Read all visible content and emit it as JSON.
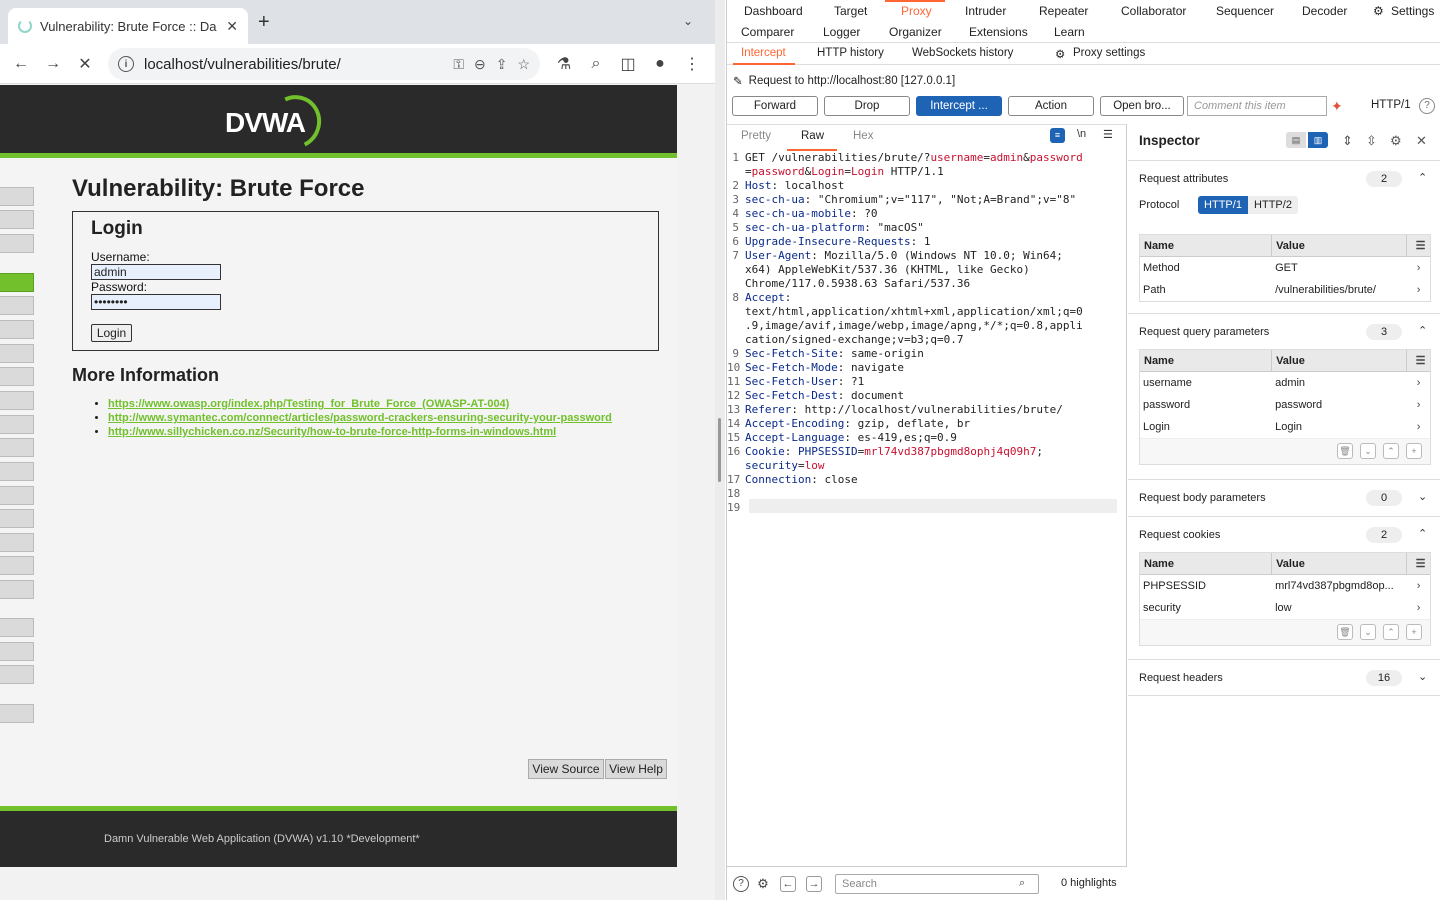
{
  "browser": {
    "tab_title": "Vulnerability: Brute Force :: Da",
    "url": "localhost/vulnerabilities/brute/"
  },
  "dvwa": {
    "logo": "DVWA",
    "page_title": "Vulnerability: Brute Force",
    "login_heading": "Login",
    "username_label": "Username:",
    "username_value": "admin",
    "password_label": "Password:",
    "password_value": "••••••••",
    "login_button": "Login",
    "more_info_heading": "More Information",
    "links": [
      "https://www.owasp.org/index.php/Testing_for_Brute_Force_(OWASP-AT-004)",
      "http://www.symantec.com/connect/articles/password-crackers-ensuring-security-your-password",
      "http://www.sillychicken.co.nz/Security/how-to-brute-force-http-forms-in-windows.html"
    ],
    "view_source": "View Source",
    "view_help": "View Help",
    "footer": "Damn Vulnerable Web Application (DVWA) v1.10 *Development*"
  },
  "burp": {
    "nav_row1": [
      "Dashboard",
      "Target",
      "Proxy",
      "Intruder",
      "Repeater",
      "Collaborator",
      "Sequencer",
      "Decoder",
      "Settings"
    ],
    "nav_row2": [
      "Comparer",
      "Logger",
      "Organizer",
      "Extensions",
      "Learn"
    ],
    "subnav": [
      "Intercept",
      "HTTP history",
      "WebSockets history",
      "Proxy settings"
    ],
    "request_to": "Request to http://localhost:80  [127.0.0.1]",
    "buttons": [
      "Forward",
      "Drop",
      "Intercept ...",
      "Action",
      "Open bro..."
    ],
    "comment_placeholder": "Comment this item",
    "http_version": "HTTP/1",
    "editor_tabs": [
      "Pretty",
      "Raw",
      "Hex"
    ],
    "newline_toggle": "\\n",
    "search_placeholder": "Search",
    "highlights": "0 highlights",
    "code_lines": [
      {
        "n": "1",
        "html": "GET /vulnerabilities/brute/?<span class='v'>username</span>=<span class='v'>admin</span>&amp;<span class='v'>password</span>"
      },
      {
        "n": "",
        "html": "=<span class='v'>password</span>&amp;<span class='v'>Login</span>=<span class='v'>Login</span> HTTP/1.1"
      },
      {
        "n": "2",
        "html": "<span class='k'>Host</span>: localhost"
      },
      {
        "n": "3",
        "html": "<span class='k'>sec-ch-ua</span>: \"Chromium\";v=\"117\", \"Not;A=Brand\";v=\"8\""
      },
      {
        "n": "4",
        "html": "<span class='k'>sec-ch-ua-mobile</span>: ?0"
      },
      {
        "n": "5",
        "html": "<span class='k'>sec-ch-ua-platform</span>: \"macOS\""
      },
      {
        "n": "6",
        "html": "<span class='k'>Upgrade-Insecure-Requests</span>: 1"
      },
      {
        "n": "7",
        "html": "<span class='k'>User-Agent</span>: Mozilla/5.0 (Windows NT 10.0; Win64;"
      },
      {
        "n": "",
        "html": "x64) AppleWebKit/537.36 (KHTML, like Gecko)"
      },
      {
        "n": "",
        "html": "Chrome/117.0.5938.63 Safari/537.36"
      },
      {
        "n": "8",
        "html": "<span class='k'>Accept</span>:"
      },
      {
        "n": "",
        "html": "text/html,application/xhtml+xml,application/xml;q=0"
      },
      {
        "n": "",
        "html": ".9,image/avif,image/webp,image/apng,*/*;q=0.8,appli"
      },
      {
        "n": "",
        "html": "cation/signed-exchange;v=b3;q=0.7"
      },
      {
        "n": "9",
        "html": "<span class='k'>Sec-Fetch-Site</span>: same-origin"
      },
      {
        "n": "10",
        "html": "<span class='k'>Sec-Fetch-Mode</span>: navigate"
      },
      {
        "n": "11",
        "html": "<span class='k'>Sec-Fetch-User</span>: ?1"
      },
      {
        "n": "12",
        "html": "<span class='k'>Sec-Fetch-Dest</span>: document"
      },
      {
        "n": "13",
        "html": "<span class='k'>Referer</span>: http://localhost/vulnerabilities/brute/"
      },
      {
        "n": "14",
        "html": "<span class='k'>Accept-Encoding</span>: gzip, deflate, br"
      },
      {
        "n": "15",
        "html": "<span class='k'>Accept-Language</span>: es-419,es;q=0.9"
      },
      {
        "n": "16",
        "html": "<span class='k'>Cookie</span>: <span class='k'>PHPSESSID</span>=<span class='v'>mrl74vd387pbgmd8ophj4q09h7</span>;"
      },
      {
        "n": "",
        "html": "<span class='k'>security</span>=<span class='v'>low</span>"
      },
      {
        "n": "17",
        "html": "<span class='k'>Connection</span>: close"
      },
      {
        "n": "18",
        "html": ""
      },
      {
        "n": "19",
        "html": ""
      }
    ]
  },
  "inspector": {
    "title": "Inspector",
    "attributes": {
      "title": "Request attributes",
      "count": "2",
      "protocol_label": "Protocol",
      "proto1": "HTTP/1",
      "proto2": "HTTP/2",
      "col_name": "Name",
      "col_value": "Value",
      "rows": [
        {
          "name": "Method",
          "value": "GET"
        },
        {
          "name": "Path",
          "value": "/vulnerabilities/brute/"
        }
      ]
    },
    "query": {
      "title": "Request query parameters",
      "count": "3",
      "rows": [
        {
          "name": "username",
          "value": "admin"
        },
        {
          "name": "password",
          "value": "password"
        },
        {
          "name": "Login",
          "value": "Login"
        }
      ]
    },
    "body": {
      "title": "Request body parameters",
      "count": "0"
    },
    "cookies": {
      "title": "Request cookies",
      "count": "2",
      "rows": [
        {
          "name": "PHPSESSID",
          "value": "mrl74vd387pbgmd8op..."
        },
        {
          "name": "security",
          "value": "low"
        }
      ]
    },
    "headers": {
      "title": "Request headers",
      "count": "16"
    }
  }
}
